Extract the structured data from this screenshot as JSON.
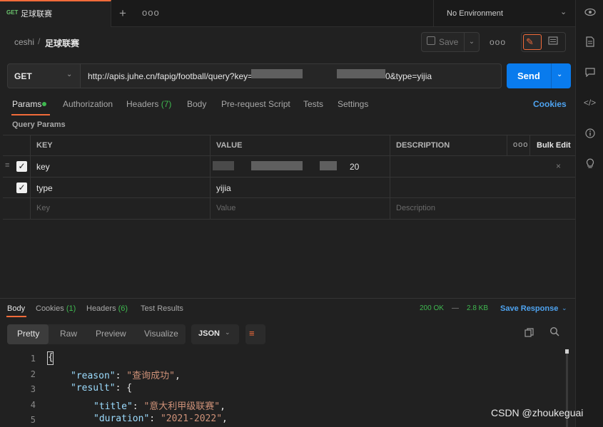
{
  "tab": {
    "method": "GET",
    "title": "足球联赛"
  },
  "env": {
    "label": "No Environment"
  },
  "breadcrumb": {
    "parent": "ceshi",
    "separator": "/",
    "current": "足球联赛"
  },
  "toolbar": {
    "save_label": "Save"
  },
  "request": {
    "method": "GET",
    "url_prefix": "http://apis.juhe.cn/fapig/football/query?key=",
    "url_suffix": "0&type=yijia",
    "send_label": "Send"
  },
  "request_tabs": {
    "params": "Params",
    "authorization": "Authorization",
    "headers": "Headers",
    "headers_count": "(7)",
    "body": "Body",
    "prerequest": "Pre-request Script",
    "tests": "Tests",
    "settings": "Settings",
    "cookies": "Cookies"
  },
  "query_params": {
    "title": "Query Params",
    "columns": {
      "key": "KEY",
      "value": "VALUE",
      "description": "DESCRIPTION",
      "bulk_edit": "Bulk Edit"
    },
    "rows": [
      {
        "key": "key",
        "value_suffix": "20",
        "checked": true
      },
      {
        "key": "type",
        "value": "yijia",
        "checked": true
      }
    ],
    "placeholders": {
      "key": "Key",
      "value": "Value",
      "description": "Description"
    }
  },
  "response": {
    "tabs": {
      "body": "Body",
      "cookies": "Cookies",
      "cookies_count": "(1)",
      "headers": "Headers",
      "headers_count": "(6)",
      "test_results": "Test Results"
    },
    "status": "200 OK",
    "separator": "—",
    "size": "2.8 KB",
    "save_response": "Save Response",
    "views": {
      "pretty": "Pretty",
      "raw": "Raw",
      "preview": "Preview",
      "visualize": "Visualize"
    },
    "format": "JSON",
    "code": {
      "line_numbers": [
        "1",
        "2",
        "3",
        "4",
        "5"
      ],
      "line1": "{",
      "reason_key": "\"reason\"",
      "reason_value": "\"查询成功\"",
      "result_key": "\"result\"",
      "title_key": "\"title\"",
      "title_value": "\"意大利甲级联赛\"",
      "duration_key": "\"duration\"",
      "duration_value": "\"2021-2022\""
    }
  },
  "watermark": "CSDN @zhoukeguai",
  "colors": {
    "accent": "#f26b3a",
    "send": "#097bed",
    "success": "#3fb950",
    "link": "#4ea3f0"
  },
  "icons": [
    "plus-icon",
    "more-icon",
    "chevron-down-icon",
    "eye-icon",
    "document-icon",
    "comment-icon",
    "code-icon",
    "info-icon",
    "bulb-icon",
    "save-icon",
    "pencil-icon",
    "drag-handle-icon",
    "close-icon",
    "wrap-icon",
    "copy-icon",
    "search-icon"
  ]
}
